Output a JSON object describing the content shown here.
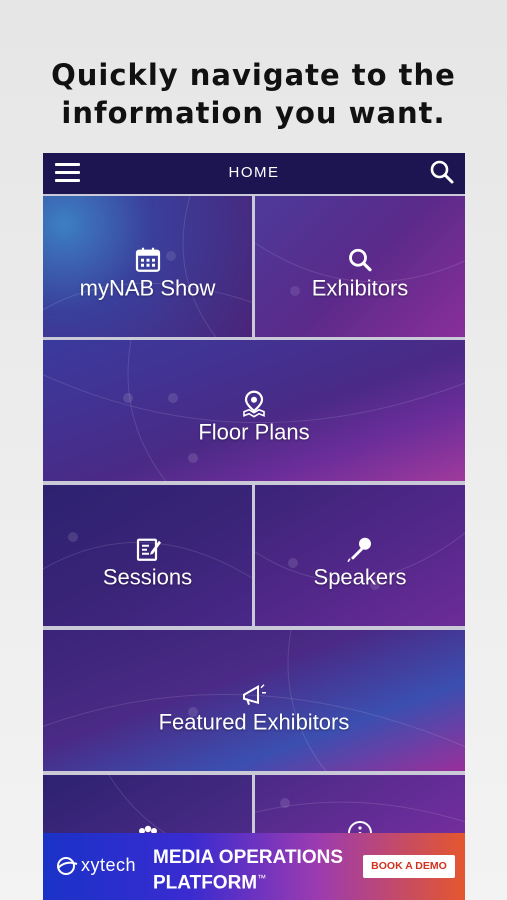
{
  "headline": {
    "line1": "Quickly navigate to the",
    "line2": "information you want."
  },
  "topbar": {
    "title": "HOME",
    "menu_icon": "hamburger-menu-icon",
    "search_icon": "search-icon"
  },
  "tiles": [
    {
      "label": "myNAB Show",
      "icon": "calendar-icon"
    },
    {
      "label": "Exhibitors",
      "icon": "search-icon"
    },
    {
      "label": "Floor Plans",
      "icon": "map-pin-icon"
    },
    {
      "label": "Sessions",
      "icon": "edit-note-icon"
    },
    {
      "label": "Speakers",
      "icon": "microphone-icon"
    },
    {
      "label": "Featured Exhibitors",
      "icon": "megaphone-icon"
    },
    {
      "label": "",
      "icon": "people-icon"
    },
    {
      "label": "",
      "icon": "info-icon"
    }
  ],
  "ad": {
    "brand": "xytech",
    "title_line1": "MEDIA OPERATIONS",
    "title_line2": "PLATFORM",
    "trademark": "™",
    "cta": "BOOK A DEMO"
  },
  "colors": {
    "topbar": "#1d1551",
    "tile_purple": "#5a2a8a",
    "tile_blue": "#3b4fb0",
    "tile_magenta": "#9a2f9a",
    "ad_cta_text": "#d0321f"
  }
}
